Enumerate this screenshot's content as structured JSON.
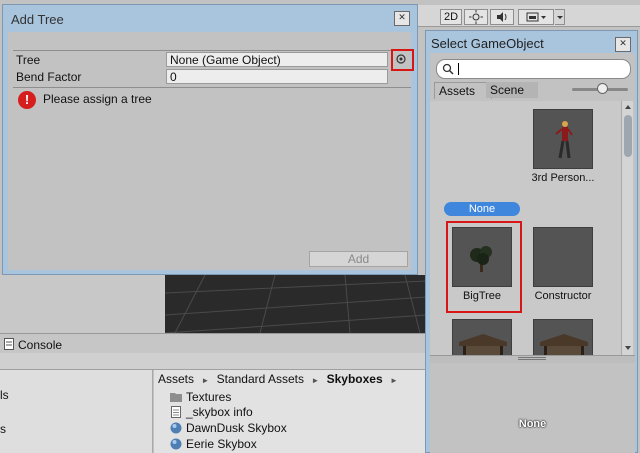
{
  "scene_toolbar": {
    "mode_2d": "2D"
  },
  "console": {
    "tab_label": "Console"
  },
  "project": {
    "breadcrumb": [
      "Assets",
      "Standard Assets",
      "Skyboxes"
    ],
    "left_fragments": [
      "ls",
      "s"
    ],
    "files": [
      {
        "name": "Textures",
        "icon": "folder-icon"
      },
      {
        "name": "_skybox info",
        "icon": "text-file-icon"
      },
      {
        "name": "DawnDusk Skybox",
        "icon": "material-sphere-icon"
      },
      {
        "name": "Eerie Skybox",
        "icon": "material-sphere-icon"
      }
    ]
  },
  "add_tree": {
    "title": "Add Tree",
    "fields": [
      {
        "label": "Tree",
        "value": "None (Game Object)"
      },
      {
        "label": "Bend Factor",
        "value": "0"
      }
    ],
    "error_message": "Please assign a tree",
    "add_button": "Add"
  },
  "select_gameobject": {
    "title": "Select GameObject",
    "search_value": "",
    "tabs": [
      "Assets",
      "Scene"
    ],
    "active_tab": "Assets",
    "items": [
      {
        "label": "None",
        "selected": true
      },
      {
        "label": "3rd Person..."
      },
      {
        "label": "BigTree"
      },
      {
        "label": "Constructor"
      }
    ],
    "preview_label": "None"
  },
  "colors": {
    "selection_blue": "#3f86dd",
    "highlight_red": "#d91616",
    "dialog_frame": "#a9c4dd"
  }
}
